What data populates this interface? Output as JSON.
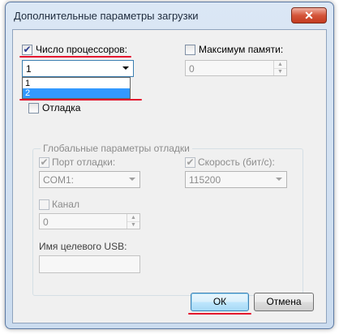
{
  "dialog": {
    "title": "Дополнительные параметры загрузки",
    "close_glyph": "✕"
  },
  "processors": {
    "label": "Число процессоров:",
    "checked": true,
    "check_glyph": "✔",
    "selected_value": "1",
    "options": [
      "1",
      "2"
    ],
    "highlighted_option": "2"
  },
  "memory": {
    "label": "Максимум памяти:",
    "checked": false,
    "value": "0"
  },
  "debug": {
    "label": "Отладка",
    "checked": false
  },
  "global_debug": {
    "group_title": "Глобальные параметры отладки",
    "port_label": "Порт отладки:",
    "port_value": "COM1:",
    "speed_label": "Скорость (бит/с):",
    "speed_value": "115200",
    "channel_label": "Канал",
    "channel_value": "0",
    "usb_label": "Имя целевого USB:",
    "usb_value": ""
  },
  "buttons": {
    "ok": "ОК",
    "cancel": "Отмена"
  },
  "icons": {
    "spin_up": "▲",
    "spin_down": "▼"
  },
  "colors": {
    "annotation": "#e4142d",
    "selection": "#3399ff"
  }
}
